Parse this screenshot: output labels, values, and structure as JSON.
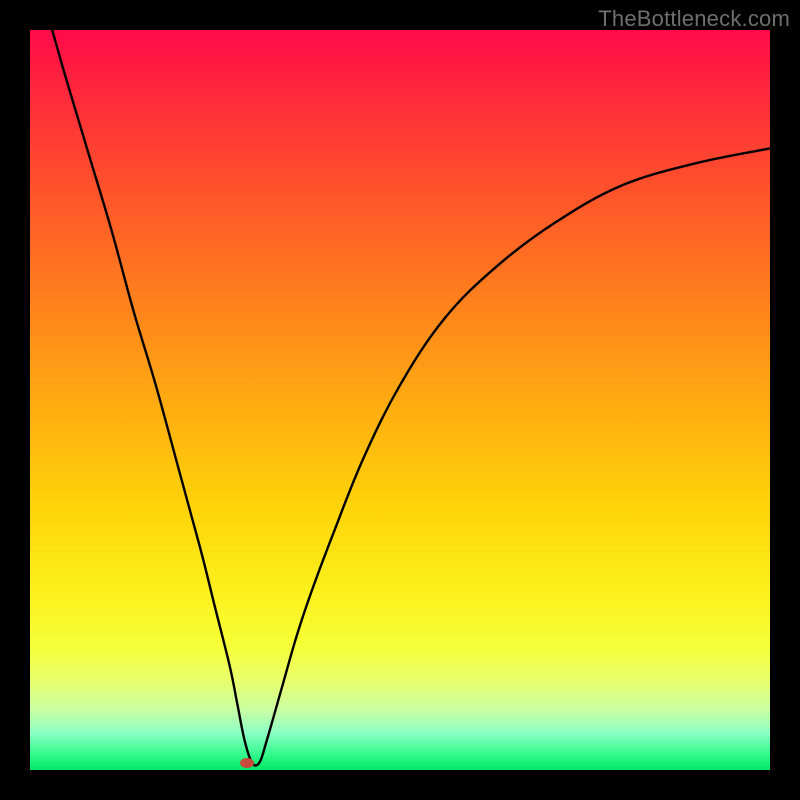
{
  "watermark": "TheBottleneck.com",
  "marker": {
    "color": "#c84a3b",
    "x_frac": 0.293,
    "y_frac": 0.99
  },
  "chart_data": {
    "type": "line",
    "title": "",
    "xlabel": "",
    "ylabel": "",
    "xlim": [
      0,
      100
    ],
    "ylim": [
      0,
      100
    ],
    "grid": false,
    "legend": false,
    "background": "red-yellow-green vertical gradient",
    "series": [
      {
        "name": "bottleneck-curve",
        "color": "#000000",
        "x": [
          3,
          5,
          8,
          11,
          14,
          17,
          20,
          23,
          25,
          27,
          28,
          29,
          30,
          31,
          32,
          34,
          36,
          38,
          41,
          45,
          50,
          56,
          63,
          71,
          80,
          90,
          100
        ],
        "y": [
          100,
          93,
          83,
          73,
          62,
          52,
          41,
          30,
          22,
          14,
          9,
          4,
          1,
          1,
          4,
          11,
          18,
          24,
          32,
          42,
          52,
          61,
          68,
          74,
          79,
          82,
          84
        ]
      }
    ],
    "annotations": [
      {
        "type": "dot",
        "x": 29.3,
        "y": 0.5,
        "color": "#c84a3b"
      }
    ]
  }
}
